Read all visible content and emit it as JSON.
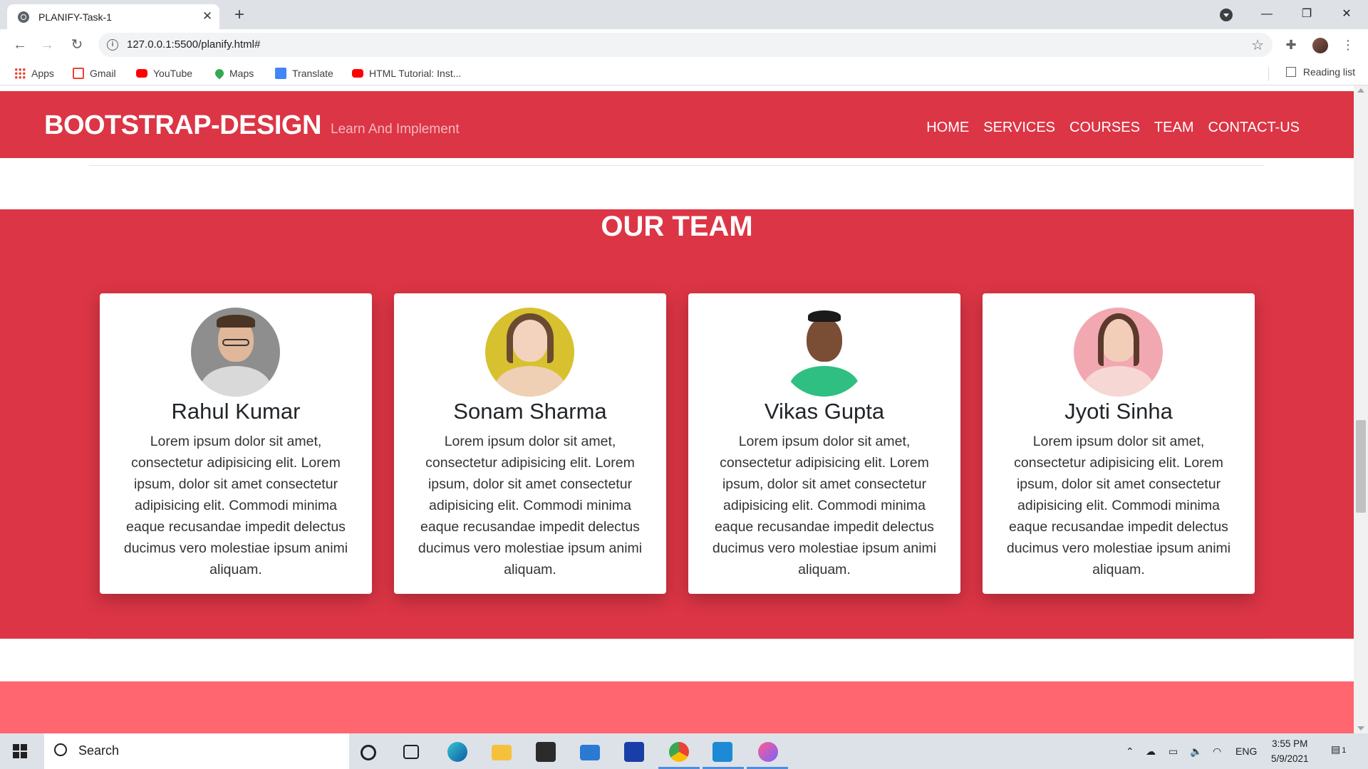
{
  "browser": {
    "tab_title": "PLANIFY-Task-1",
    "tab_close": "✕",
    "new_tab": "+",
    "url": "127.0.0.1:5500/planify.html#",
    "bookmarks": [
      "Apps",
      "Gmail",
      "YouTube",
      "Maps",
      "Translate",
      "HTML Tutorial: Inst..."
    ],
    "reading_list": "Reading list"
  },
  "site": {
    "brand": "BOOTSTRAP-DESIGN",
    "tagline": "Learn And Implement",
    "nav": [
      "HOME",
      "SERVICES",
      "COURSES",
      "TEAM",
      "CONTACT-US"
    ]
  },
  "team": {
    "title": "OUR TEAM",
    "members": [
      {
        "name": "Rahul Kumar",
        "text": "Lorem ipsum dolor sit amet, consectetur adipisicing elit. Lorem ipsum, dolor sit amet consectetur adipisicing elit. Commodi minima eaque recusandae impedit delectus ducimus vero molestiae ipsum animi aliquam."
      },
      {
        "name": "Sonam Sharma",
        "text": "Lorem ipsum dolor sit amet, consectetur adipisicing elit. Lorem ipsum, dolor sit amet consectetur adipisicing elit. Commodi minima eaque recusandae impedit delectus ducimus vero molestiae ipsum animi aliquam."
      },
      {
        "name": "Vikas Gupta",
        "text": "Lorem ipsum dolor sit amet, consectetur adipisicing elit. Lorem ipsum, dolor sit amet consectetur adipisicing elit. Commodi minima eaque recusandae impedit delectus ducimus vero molestiae ipsum animi aliquam."
      },
      {
        "name": "Jyoti Sinha",
        "text": "Lorem ipsum dolor sit amet, consectetur adipisicing elit. Lorem ipsum, dolor sit amet consectetur adipisicing elit. Commodi minima eaque recusandae impedit delectus ducimus vero molestiae ipsum animi aliquam."
      }
    ]
  },
  "taskbar": {
    "search_placeholder": "Search",
    "lang": "ENG",
    "time": "3:55 PM",
    "date": "5/9/2021",
    "notification_count": "1"
  },
  "colors": {
    "brand_red": "#dc3545",
    "pink_band": "#ff6670"
  }
}
